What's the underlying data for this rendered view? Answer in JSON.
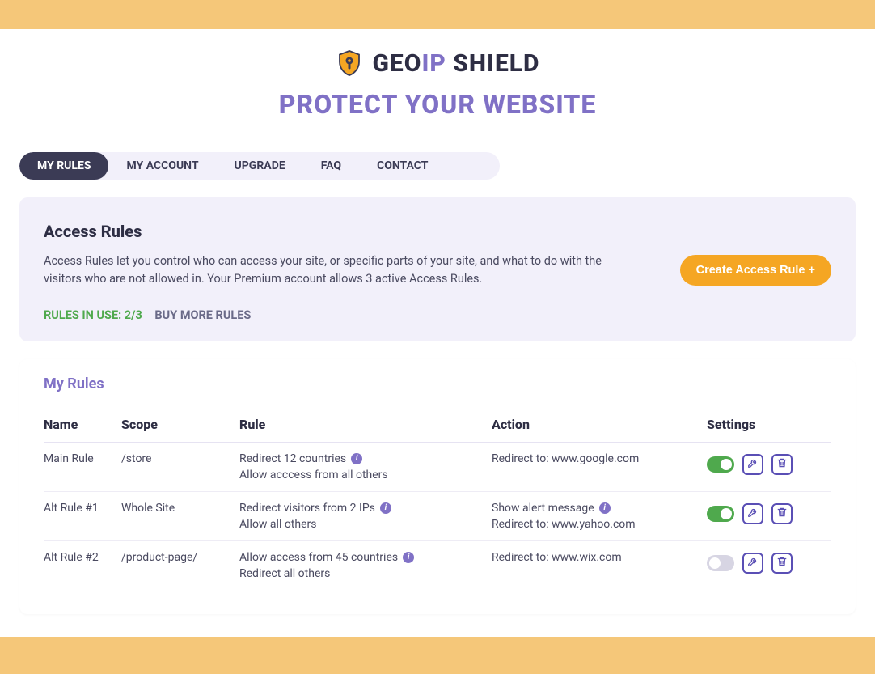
{
  "brand": {
    "name_part1": "GEO",
    "name_part2": "IP",
    "name_part3": " SHIELD",
    "tagline": "PROTECT YOUR WEBSITE"
  },
  "tabs": [
    {
      "label": "MY RULES",
      "active": true
    },
    {
      "label": "MY ACCOUNT",
      "active": false
    },
    {
      "label": "UPGRADE",
      "active": false
    },
    {
      "label": "FAQ",
      "active": false
    },
    {
      "label": "CONTACT",
      "active": false
    }
  ],
  "panel": {
    "title": "Access Rules",
    "description": "Access Rules let you control who can access your site, or specific parts of your site, and what to do with the visitors who are not allowed in. Your Premium account allows 3 active Access Rules.",
    "create_button": "Create Access Rule +",
    "rules_in_use": "RULES IN USE: 2/3",
    "buy_more": "BUY MORE RULES"
  },
  "rules": {
    "heading": "My Rules",
    "columns": {
      "name": "Name",
      "scope": "Scope",
      "rule": "Rule",
      "action": "Action",
      "settings": "Settings"
    },
    "rows": [
      {
        "name": "Main Rule",
        "scope": "/store",
        "rule_line1": "Redirect 12 countries",
        "rule_line1_info": true,
        "rule_line2": "Allow acccess from all others",
        "action_line1": "Redirect to: www.google.com",
        "action_line1_info": false,
        "action_line2": "",
        "enabled": true
      },
      {
        "name": "Alt Rule #1",
        "scope": "Whole Site",
        "rule_line1": "Redirect visitors from 2 IPs",
        "rule_line1_info": true,
        "rule_line2": "Allow all others",
        "action_line1": "Show alert message",
        "action_line1_info": true,
        "action_line2": "Redirect to: www.yahoo.com",
        "enabled": true
      },
      {
        "name": "Alt Rule #2",
        "scope": "/product-page/",
        "rule_line1": "Allow access from 45 countries",
        "rule_line1_info": true,
        "rule_line2": "Redirect all others",
        "action_line1": "Redirect to: www.wix.com",
        "action_line1_info": false,
        "action_line2": "",
        "enabled": false
      }
    ]
  }
}
